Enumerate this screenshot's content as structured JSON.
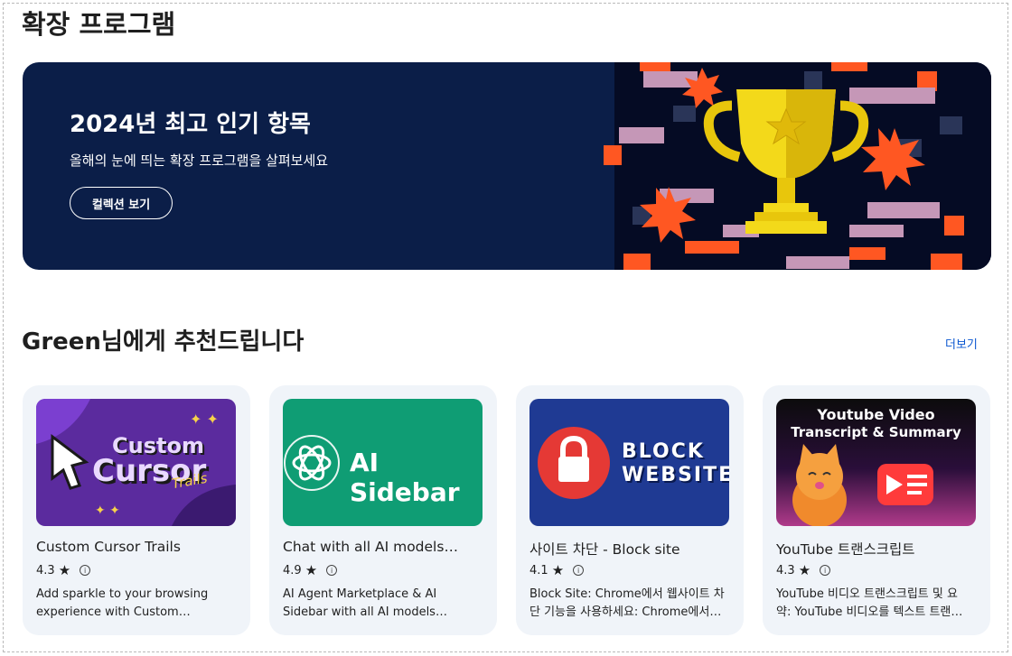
{
  "page_title": "확장 프로그램",
  "banner": {
    "title": "2024년 최고 인기 항목",
    "subtitle": "올해의 눈에 띄는 확장 프로그램을 살펴보세요",
    "button_label": "컬렉션 보기"
  },
  "section": {
    "title": "Green님에게 추천드립니다",
    "more_label": "더보기"
  },
  "cards": [
    {
      "name": "Custom Cursor Trails",
      "rating": "4.3",
      "description": "Add sparkle to your browsing experience with Custom Cursor…",
      "thumb": {
        "line1": "Custom",
        "line2": "Cursor",
        "line3": "Trails"
      }
    },
    {
      "name": "Chat with all AI models…",
      "rating": "4.9",
      "description": "AI Agent Marketplace & AI Sidebar with all AI models (Gemini, Claud…",
      "thumb": {
        "text": "AI Sidebar"
      }
    },
    {
      "name": "사이트 차단 - Block site",
      "rating": "4.1",
      "description": "Block Site: Chrome에서 웹사이트 차단 기능을 사용하세요: Chrome에서…",
      "thumb": {
        "line1": "BLOCK",
        "line2": "WEBSITES"
      }
    },
    {
      "name": "YouTube 트랜스크립트",
      "rating": "4.3",
      "description": "YouTube 비디오 트랜스크립트 및 요약: YouTube 비디오를 텍스트 트랜…",
      "thumb": {
        "line1": "Youtube Video",
        "line2": "Transcript & Summary"
      }
    }
  ],
  "colors": {
    "banner_bg": "#0b1e48",
    "card_bg": "#f0f4f9",
    "link": "#0b57d0",
    "ai_sidebar_green": "#0f9d74",
    "block_blue": "#1f3a93",
    "block_red": "#e53935"
  },
  "icons": [
    "star-icon",
    "info-icon",
    "trophy-icon",
    "lock-icon",
    "openai-logo-icon",
    "play-icon"
  ]
}
